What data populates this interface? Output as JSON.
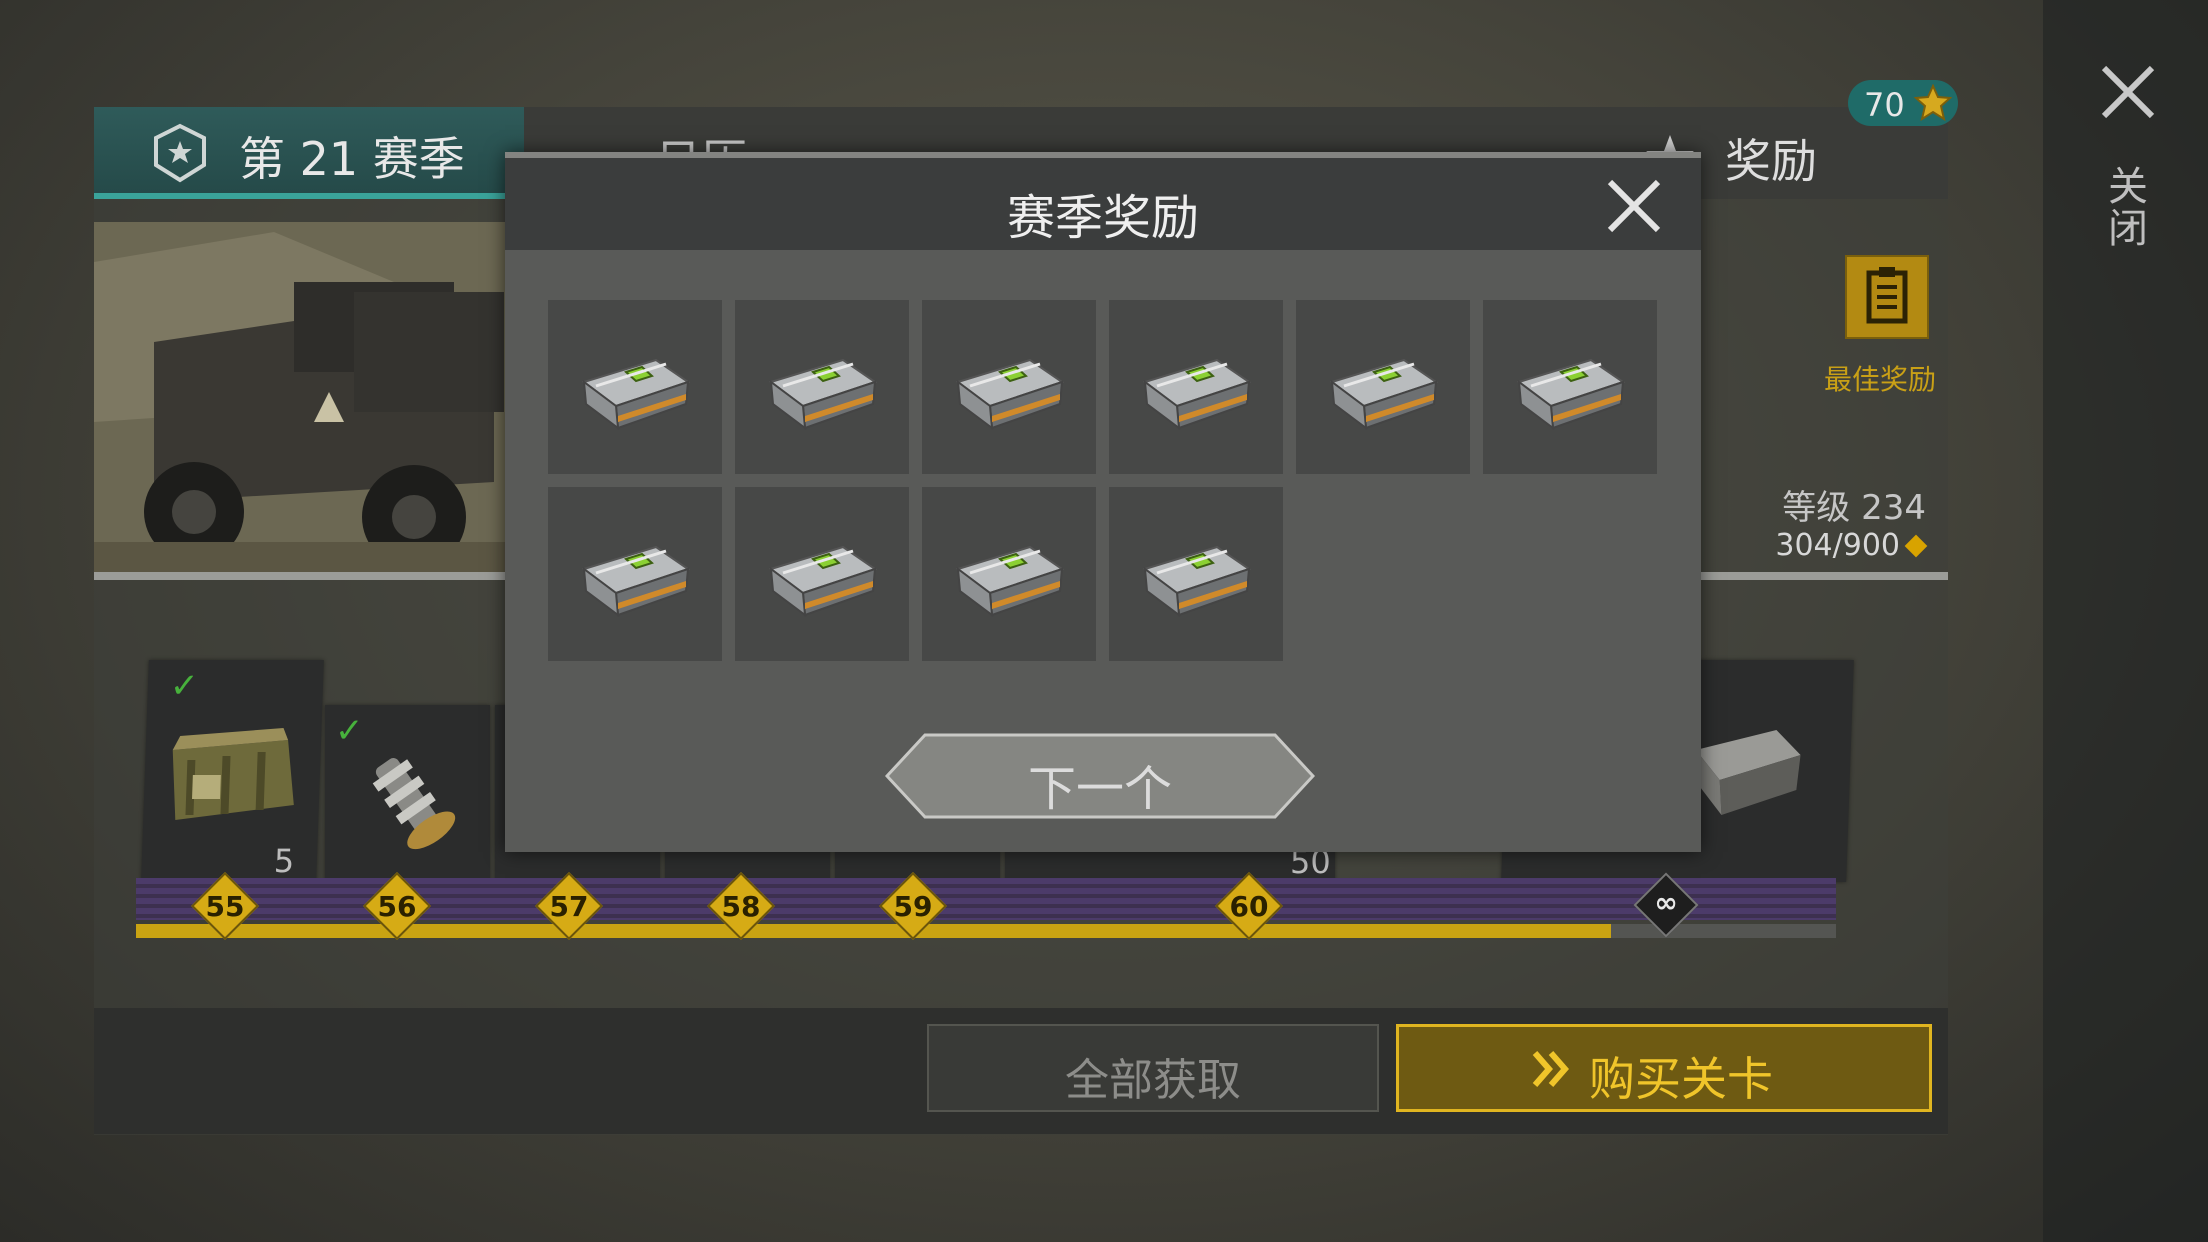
{
  "side": {
    "close_label": "关闭"
  },
  "header": {
    "season_tab": "第 21 赛季",
    "log_tab": "日历",
    "rewards_tab": "奖励",
    "badge_count": "70"
  },
  "info": {
    "best_reward": "最佳奖励",
    "level": "等级 234",
    "xp": "304/900"
  },
  "track": {
    "items": [
      {
        "level": "55",
        "count": "5",
        "claimed": true
      },
      {
        "level": "56",
        "count": "",
        "claimed": true
      },
      {
        "level": "57",
        "count": ""
      },
      {
        "level": "58",
        "count": ""
      },
      {
        "level": "59",
        "count": ""
      },
      {
        "level": "60",
        "count": "50"
      }
    ],
    "infinity": "∞"
  },
  "bottom": {
    "claim_all": "全部获取",
    "buy_level": "购买关卡"
  },
  "modal": {
    "title": "赛季奖励",
    "slot_count": 10,
    "next": "下一个"
  },
  "colors": {
    "accent_gold": "#d6ab15",
    "teal": "#2f5b5a",
    "claimed_check": "#47b13c"
  }
}
